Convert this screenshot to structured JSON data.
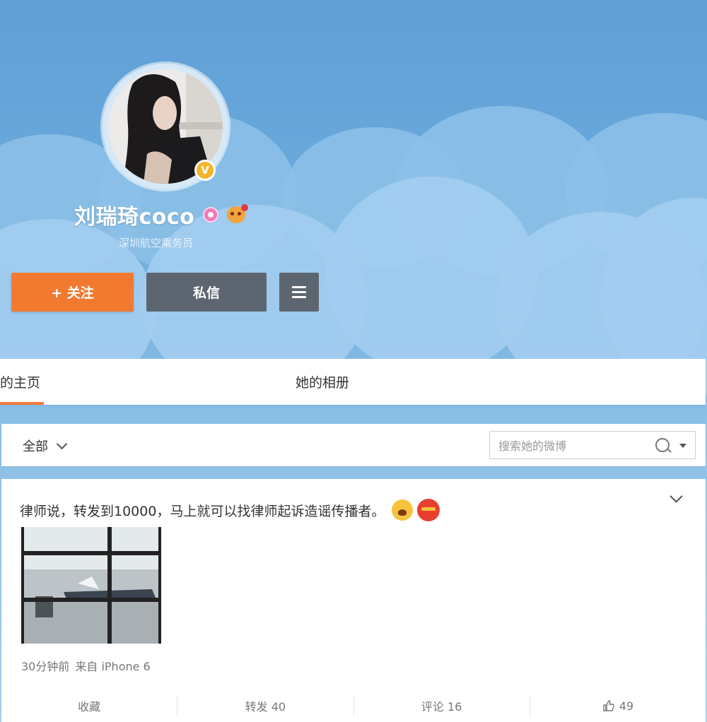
{
  "profile": {
    "username": "刘瑞琦coco",
    "description": "深圳航空乘务员",
    "verify_mark": "V"
  },
  "buttons": {
    "follow": "+ 关注",
    "message": "私信"
  },
  "tabs": {
    "home": "的主页",
    "album": "她的相册"
  },
  "filter": {
    "all": "全部",
    "search_placeholder": "搜索她的微博"
  },
  "post": {
    "text": "律师说，转发到10000，马上就可以找律师起诉造谣传播者。",
    "time": "30分钟前",
    "source": "来自 iPhone 6",
    "actions": {
      "favorite": "收藏",
      "repost": "转发 40",
      "comment": "评论 16",
      "like": "49"
    }
  },
  "colors": {
    "follow_button": "#f27a30",
    "secondary_button": "#5d6670",
    "tab_underline": "#f07a3a",
    "sky": "#6cabdc"
  }
}
